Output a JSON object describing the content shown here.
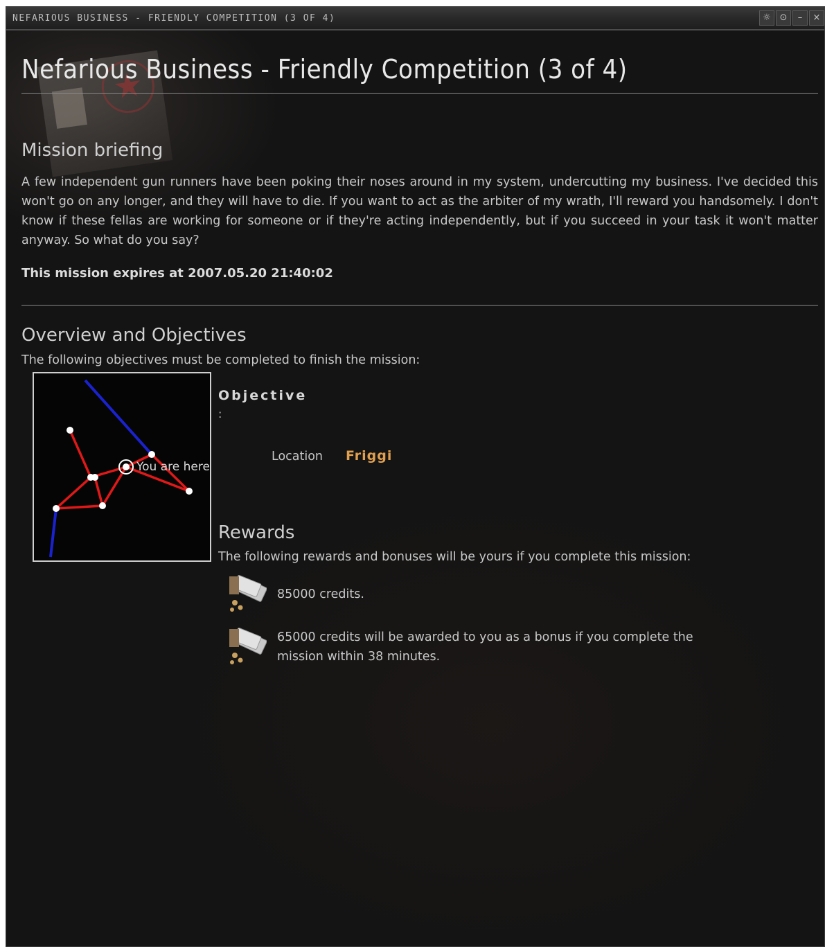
{
  "window": {
    "title": "NEFARIOUS BUSINESS - FRIENDLY COMPETITION (3 OF 4)",
    "buttons": [
      "settings-icon",
      "pin-icon",
      "minimize-icon",
      "close-icon"
    ]
  },
  "page": {
    "heading": "Nefarious Business - Friendly Competition (3 of 4)"
  },
  "briefing": {
    "heading": "Mission briefing",
    "text": "A few independent gun runners have been poking their noses around in my system, undercutting my business. I've decided this won't go on any longer, and they will have to die. If you want to act as the arbiter of my wrath, I'll reward you handsomely. I don't know if these fellas are working for someone or if they're acting independently, but if you succeed in your task it won't matter anyway. So what do you say?",
    "expires": "This mission expires at 2007.05.20 21:40:02"
  },
  "overview": {
    "heading": "Overview and Objectives",
    "subtitle": "The following objectives must be completed to finish the mission:",
    "map_label": "You are here",
    "objective_title": "Objective",
    "objective_colon": ":",
    "location_label": "Location",
    "location_value": "Friggi"
  },
  "rewards": {
    "heading": "Rewards",
    "subtitle": "The following rewards and bonuses will be yours if you complete this mission:",
    "items": [
      {
        "text": "85000 credits.",
        "icon": "credits-icon"
      },
      {
        "text": "65000 credits will be awarded to you as a bonus if you complete the mission within 38 minutes.",
        "icon": "credits-icon"
      }
    ]
  },
  "colors": {
    "location_highlight": "#e0a050",
    "route_red": "#e01818",
    "route_blue": "#1a22d0"
  }
}
